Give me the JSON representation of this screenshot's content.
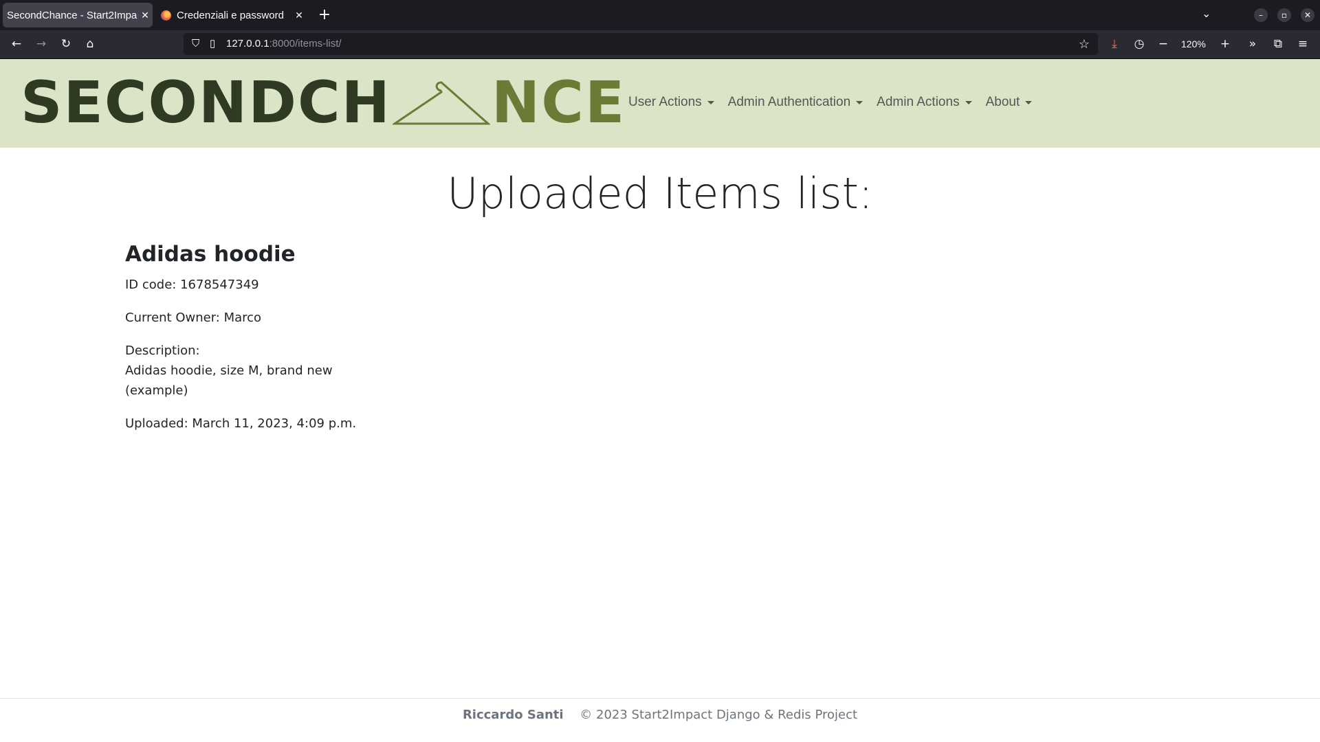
{
  "browser": {
    "tabs": [
      {
        "label": "SecondChance - Start2Impac",
        "active": true
      },
      {
        "label": "Credenziali e password",
        "active": false
      }
    ],
    "new_tab_label": "+",
    "url_host": "127.0.0.1",
    "url_path": ":8000/items-list/",
    "zoom": "120%"
  },
  "site": {
    "logo_part1": "SECONDCH",
    "logo_part2": "NCE",
    "nav": [
      "User Actions",
      "Admin Authentication",
      "Admin Actions",
      "About"
    ],
    "colors": {
      "header_bg": "#dce4c8",
      "logo_dark": "#2f3a23",
      "logo_green": "#6b7a35"
    }
  },
  "main": {
    "title": "Uploaded Items list:",
    "item": {
      "name": "Adidas hoodie",
      "id_code": "ID code: 1678547349",
      "owner": "Current Owner: Marco",
      "description_label": "Description:",
      "description": "Adidas hoodie, size M, brand new (example)",
      "uploaded": "Uploaded: March 11, 2023, 4:09 p.m."
    }
  },
  "footer": {
    "author": "Riccardo Santi",
    "text": "© 2023 Start2Impact Django & Redis Project"
  }
}
